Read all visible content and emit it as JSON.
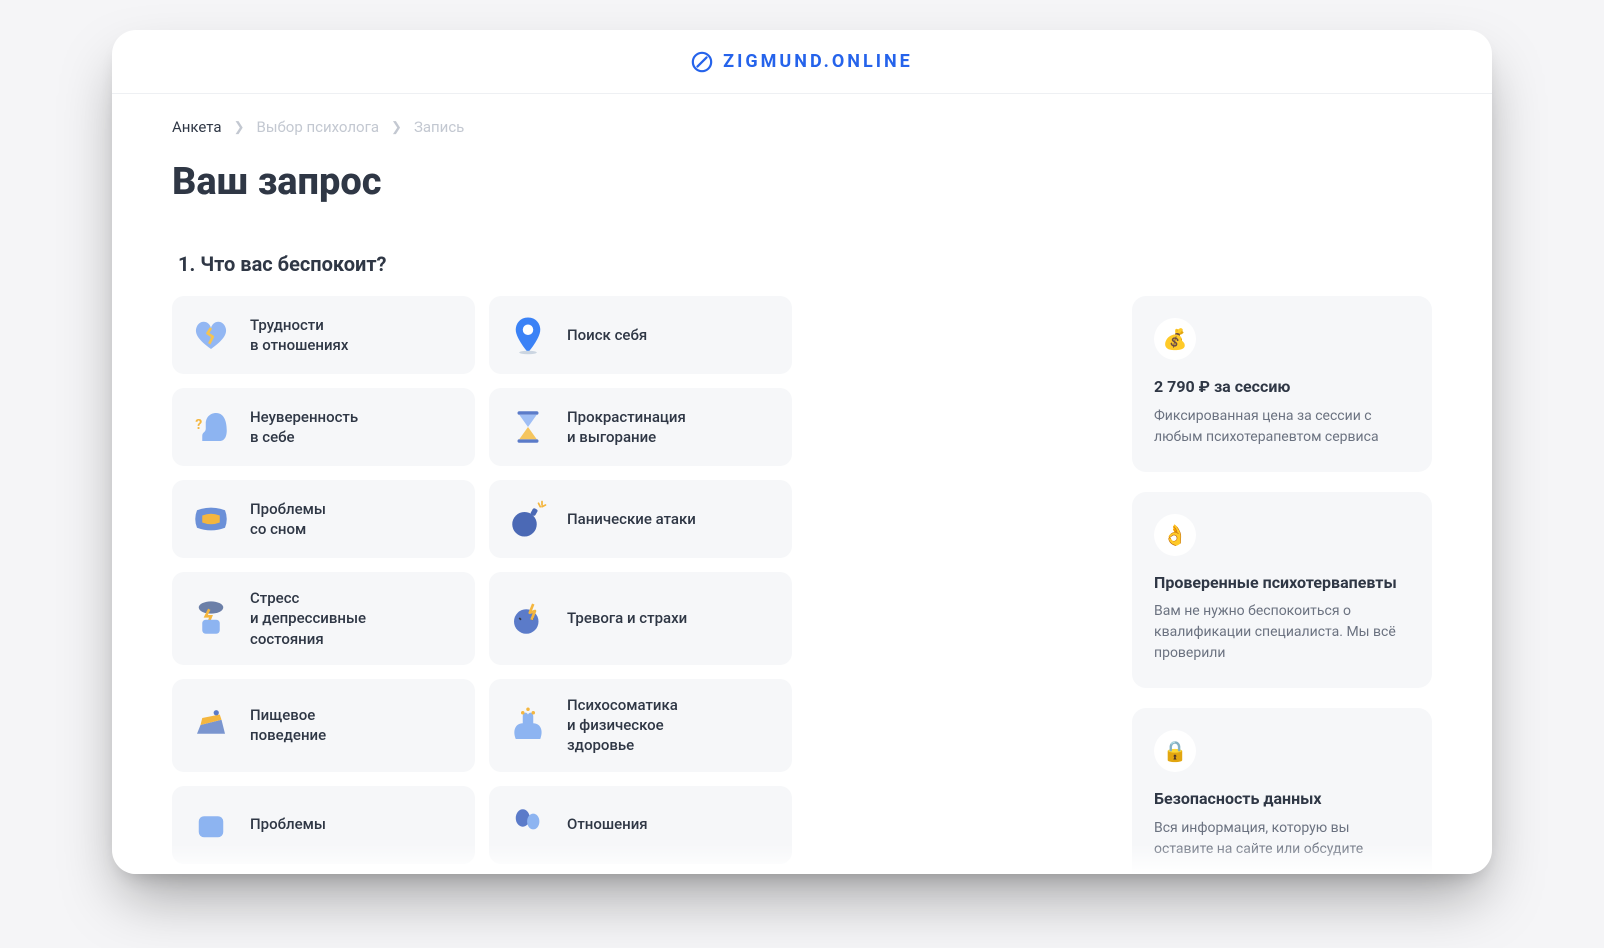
{
  "brand": {
    "name": "ZIGMUND.ONLINE"
  },
  "breadcrumb": {
    "step1": "Анкета",
    "step2": "Выбор психолога",
    "step3": "Запись"
  },
  "page": {
    "title": "Ваш запрос",
    "question": "1. Что вас беспокоит?"
  },
  "topics": [
    {
      "id": "relationships",
      "label": "Трудности\nв отношениях"
    },
    {
      "id": "find-self",
      "label": "Поиск себя"
    },
    {
      "id": "confidence",
      "label": "Неуверенность\nв себе"
    },
    {
      "id": "burnout",
      "label": "Прокрастинация\nи выгорание"
    },
    {
      "id": "sleep",
      "label": "Проблемы\nсо сном"
    },
    {
      "id": "panic",
      "label": "Панические атаки"
    },
    {
      "id": "stress",
      "label": "Стресс\nи депрессивные\nсостояния"
    },
    {
      "id": "anxiety",
      "label": "Тревога и страхи"
    },
    {
      "id": "eating",
      "label": "Пищевое\nповедение"
    },
    {
      "id": "psychosomatic",
      "label": "Психосоматика\nи физическое\nздоровье"
    },
    {
      "id": "problems",
      "label": "Проблемы"
    },
    {
      "id": "relations",
      "label": "Отношения"
    }
  ],
  "sidebar": {
    "cards": [
      {
        "id": "price",
        "icon": "money-bag-icon",
        "title": "2 790 ₽ за сессию",
        "text": "Фиксированная цена за сессии с любым психотерапевтом сервиса"
      },
      {
        "id": "verified",
        "icon": "ok-hand-icon",
        "title": "Проверенные психотервапевты",
        "text": "Вам не нужно беспокоиться о квалификации специалиста. Мы всё проверили"
      },
      {
        "id": "security",
        "icon": "lock-icon",
        "title": "Безопасность данных",
        "text": "Вся информация, которую вы оставите на сайте или обсудите"
      }
    ]
  }
}
